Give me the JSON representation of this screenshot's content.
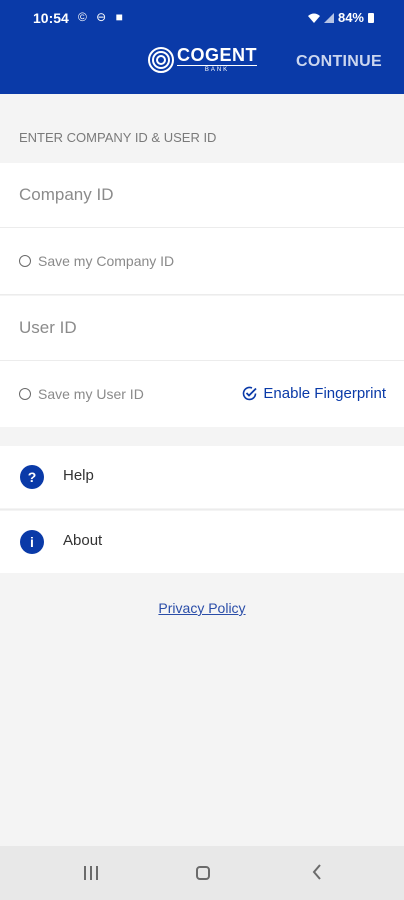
{
  "status_bar": {
    "time": "10:54",
    "left_icons": "© ⊖ ■",
    "battery": "84%"
  },
  "header": {
    "logo_name": "COGENT",
    "logo_sub": "BANK",
    "continue_label": "CONTINUE"
  },
  "form": {
    "section_label": "ENTER COMPANY ID & USER ID",
    "company_id_placeholder": "Company ID",
    "save_company_id_label": "Save my Company ID",
    "user_id_placeholder": "User ID",
    "save_user_id_label": "Save my User ID",
    "enable_fingerprint_label": "Enable Fingerprint"
  },
  "menu": {
    "help_label": "Help",
    "help_icon": "question-icon",
    "about_label": "About",
    "about_icon": "info-icon"
  },
  "footer": {
    "privacy_policy_label": "Privacy Policy"
  },
  "colors": {
    "brand_blue": "#0a3aa8",
    "background": "#f4f4f4"
  }
}
